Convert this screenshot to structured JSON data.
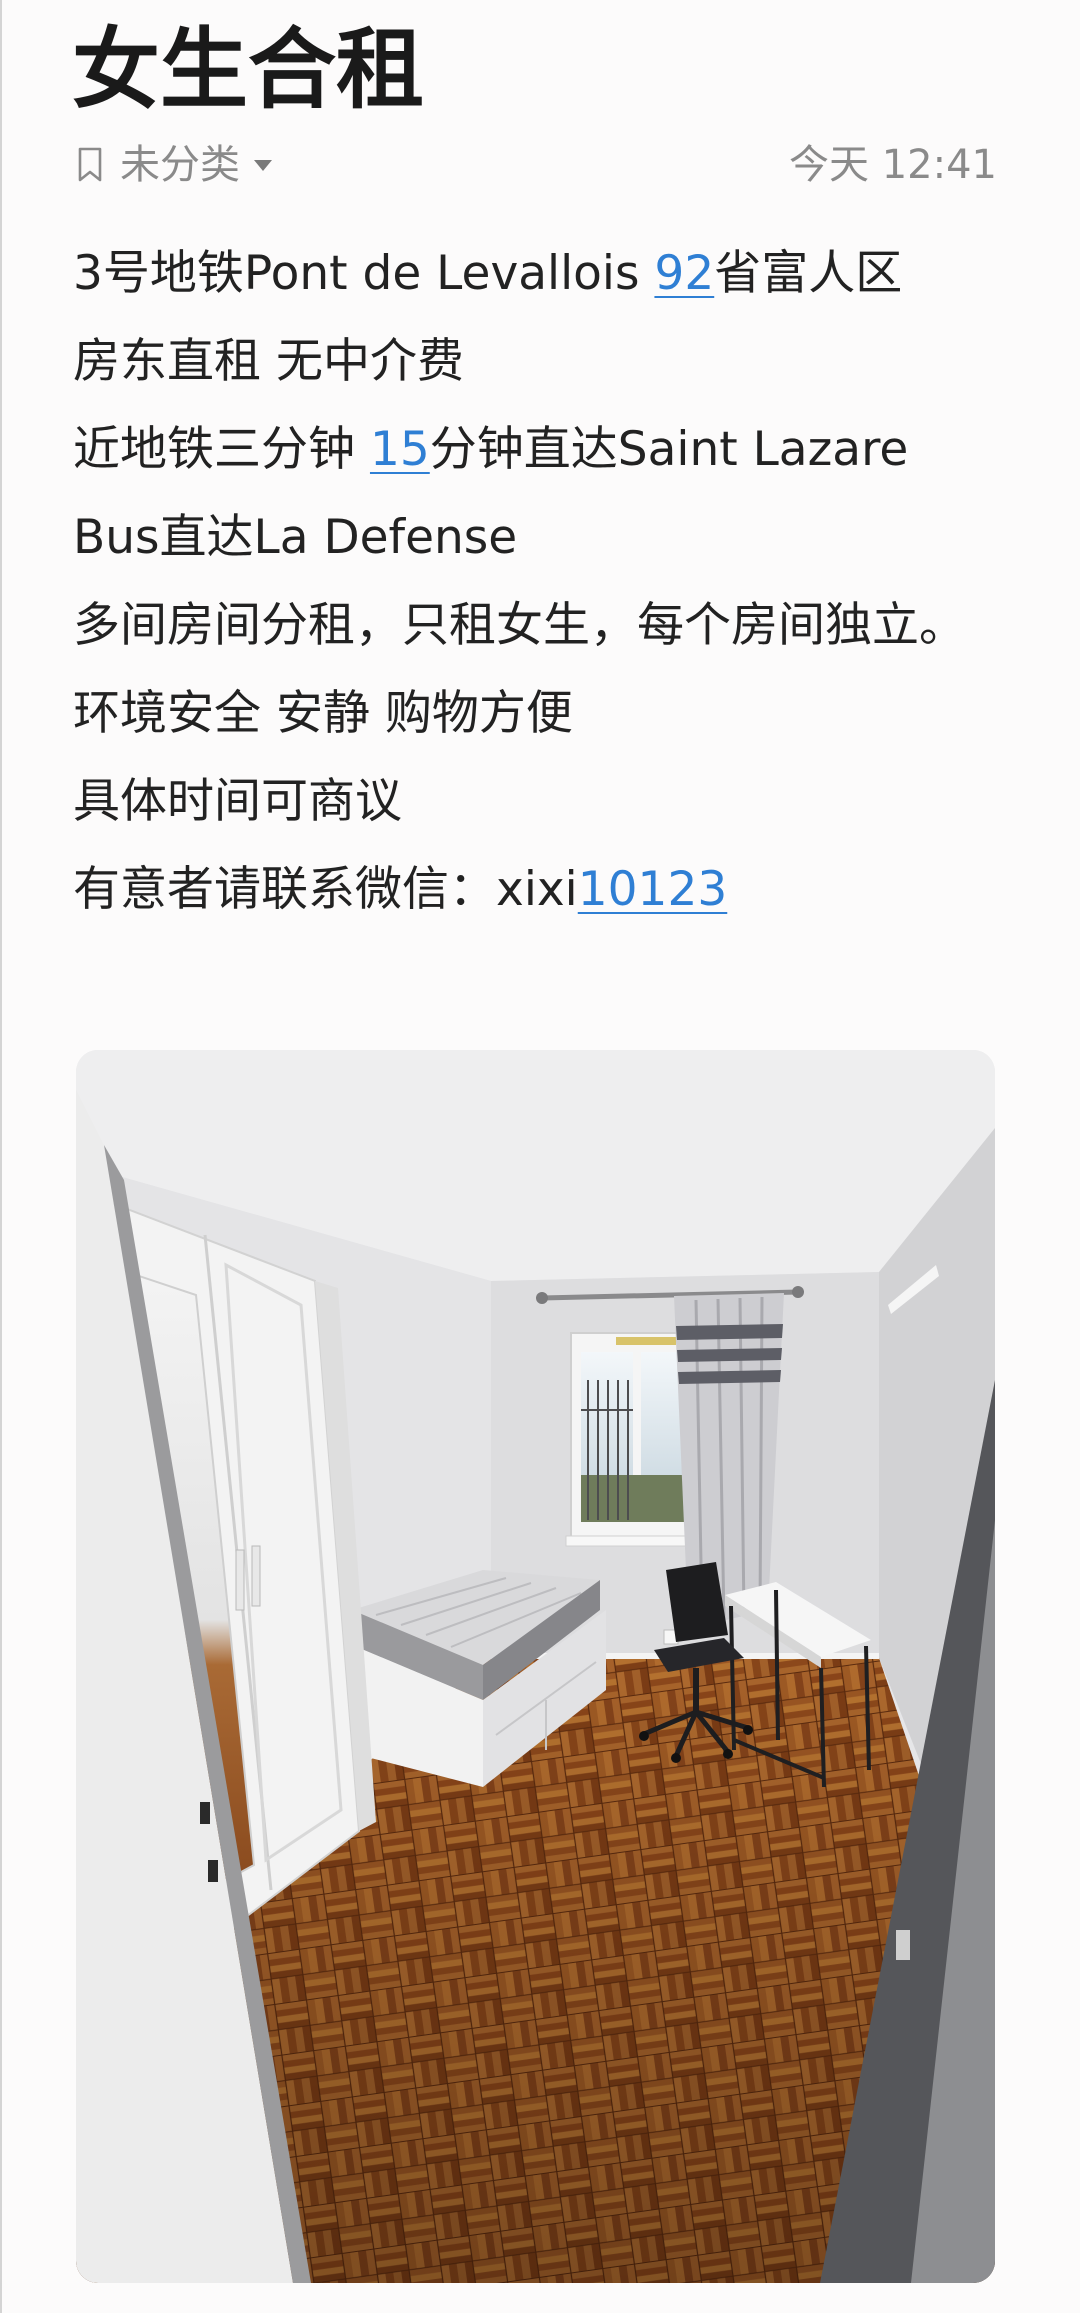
{
  "note": {
    "title": "女生合租",
    "category": "未分类",
    "time": "今天 12:41",
    "body": [
      [
        {
          "text": "3号地铁Pont de Levallois "
        },
        {
          "text": "92",
          "link": true
        },
        {
          "text": "省富人区"
        }
      ],
      [
        {
          "text": "房东直租 无中介费"
        }
      ],
      [
        {
          "text": "近地铁三分钟 "
        },
        {
          "text": "15",
          "link": true
        },
        {
          "text": "分钟直达Saint Lazare"
        }
      ],
      [
        {
          "text": "Bus直达La Defense"
        }
      ],
      [
        {
          "text": "多间房间分租，只租女生，每个房间独立。"
        }
      ],
      [
        {
          "text": "环境安全 安静 购物方便"
        }
      ],
      [
        {
          "text": "具体时间可商议"
        }
      ],
      [
        {
          "text": "有意者请联系微信：xixi"
        },
        {
          "text": "10123",
          "link": true
        }
      ]
    ]
  },
  "icons": {
    "category": "bookmark-icon",
    "dropdown": "dropdown-triangle-icon"
  },
  "colors": {
    "text": "#222222",
    "meta": "#8a8a8a",
    "link": "#2f7fd4",
    "background": "#fcfbfb"
  }
}
